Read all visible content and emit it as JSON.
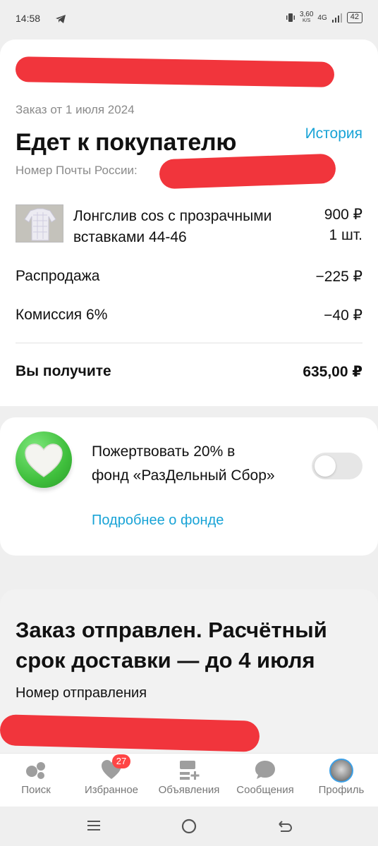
{
  "status_bar": {
    "time": "14:58",
    "speed": "3,60",
    "speed_unit": "K/S",
    "network": "4G",
    "battery": "42"
  },
  "order": {
    "date_text": "Заказ от 1 июля 2024",
    "status_title": "Едет к покупателю",
    "history_link": "История",
    "post_label": "Номер Почты России:"
  },
  "product": {
    "name": "Лонгслив cos с прозрачными вставками 44-46",
    "price": "900 ₽",
    "quantity": "1 шт."
  },
  "rows": [
    {
      "label": "Распродажа",
      "value": "−225 ₽"
    },
    {
      "label": "Комиссия 6%",
      "value": "−40 ₽"
    }
  ],
  "total": {
    "label": "Вы получите",
    "value": "635,00 ₽"
  },
  "donate": {
    "text": "Пожертвовать 20% в фонд «РазДельный Сбор»",
    "link": "Подробнее о фонде",
    "enabled": false
  },
  "shipment": {
    "title": "Заказ отправлен. Расчётный срок доставки — до 4 июля",
    "number_label": "Номер отправления"
  },
  "nav": {
    "items": [
      {
        "label": "Поиск",
        "icon": "search-icon"
      },
      {
        "label": "Избранное",
        "icon": "heart-icon",
        "badge": "27"
      },
      {
        "label": "Объявления",
        "icon": "listings-icon"
      },
      {
        "label": "Сообщения",
        "icon": "chat-icon"
      },
      {
        "label": "Профиль",
        "icon": "avatar"
      }
    ]
  },
  "colors": {
    "accent": "#18a3d6",
    "redaction": "#f1353c",
    "badge": "#ff4545"
  }
}
